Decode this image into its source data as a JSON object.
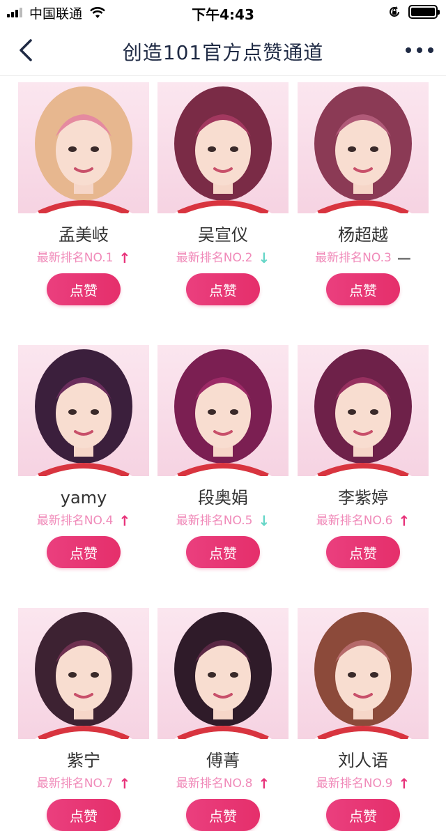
{
  "status_bar": {
    "carrier": "中国联通",
    "time": "下午4:43"
  },
  "nav": {
    "title": "创造101官方点赞通道"
  },
  "colors": {
    "accent": "#e8337a",
    "rank_text": "#f08ab9",
    "trend_down": "#66d6c7",
    "trend_same": "#777777"
  },
  "contestants": [
    {
      "name": "孟美岐",
      "rank": "最新排名NO.1",
      "trend": "up",
      "trend_symbol": "↑",
      "button": "点赞",
      "hair": "#e7b78f",
      "hair2": "#e58aa0"
    },
    {
      "name": "吴宣仪",
      "rank": "最新排名NO.2",
      "trend": "down",
      "trend_symbol": "↓",
      "button": "点赞",
      "hair": "#7a2b46",
      "hair2": "#a2385f"
    },
    {
      "name": "杨超越",
      "rank": "最新排名NO.3",
      "trend": "same",
      "trend_symbol": "—",
      "button": "点赞",
      "hair": "#8b3a55",
      "hair2": "#b05a78"
    },
    {
      "name": "yamy",
      "rank": "最新排名NO.4",
      "trend": "up",
      "trend_symbol": "↑",
      "button": "点赞",
      "hair": "#3b1f3c",
      "hair2": "#6a2d5c"
    },
    {
      "name": "段奥娟",
      "rank": "最新排名NO.5",
      "trend": "down",
      "trend_symbol": "↓",
      "button": "点赞",
      "hair": "#7b1f52",
      "hair2": "#9c2a66"
    },
    {
      "name": "李紫婷",
      "rank": "最新排名NO.6",
      "trend": "up",
      "trend_symbol": "↑",
      "button": "点赞",
      "hair": "#6e2149",
      "hair2": "#96305f"
    },
    {
      "name": "紫宁",
      "rank": "最新排名NO.7",
      "trend": "up",
      "trend_symbol": "↑",
      "button": "点赞",
      "hair": "#3d2232",
      "hair2": "#6e3150"
    },
    {
      "name": "傅菁",
      "rank": "最新排名NO.8",
      "trend": "up",
      "trend_symbol": "↑",
      "button": "点赞",
      "hair": "#2f1b29",
      "hair2": "#5a2844"
    },
    {
      "name": "刘人语",
      "rank": "最新排名NO.9",
      "trend": "up",
      "trend_symbol": "↑",
      "button": "点赞",
      "hair": "#8c4a3a",
      "hair2": "#b56a6a"
    }
  ]
}
